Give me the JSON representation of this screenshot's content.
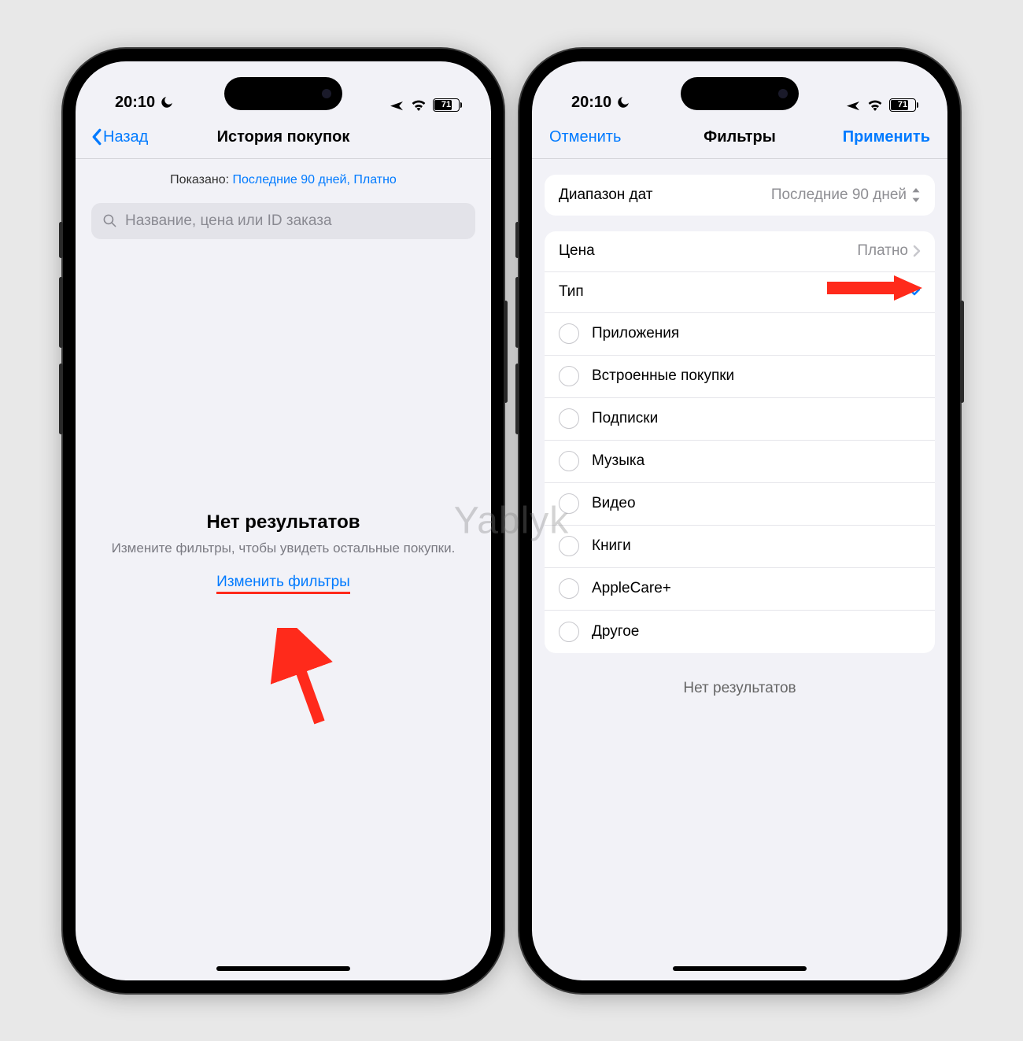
{
  "watermark": "Yablyk",
  "status": {
    "time": "20:10",
    "battery": "71"
  },
  "left_phone": {
    "nav": {
      "back": "Назад",
      "title": "История покупок"
    },
    "shown_prefix": "Показано: ",
    "shown_value": "Последние 90 дней, Платно",
    "search_placeholder": "Название, цена или ID заказа",
    "empty": {
      "title": "Нет результатов",
      "subtitle": "Измените фильтры, чтобы увидеть остальные покупки.",
      "cta": "Изменить фильтры"
    }
  },
  "right_phone": {
    "nav": {
      "cancel": "Отменить",
      "title": "Фильтры",
      "apply": "Применить"
    },
    "date_range": {
      "label": "Диапазон дат",
      "value": "Последние 90 дней"
    },
    "price": {
      "label": "Цена",
      "value": "Платно"
    },
    "type_label": "Тип",
    "type_options": [
      "Приложения",
      "Встроенные покупки",
      "Подписки",
      "Музыка",
      "Видео",
      "Книги",
      "AppleCare+",
      "Другое"
    ],
    "footer": "Нет результатов"
  }
}
